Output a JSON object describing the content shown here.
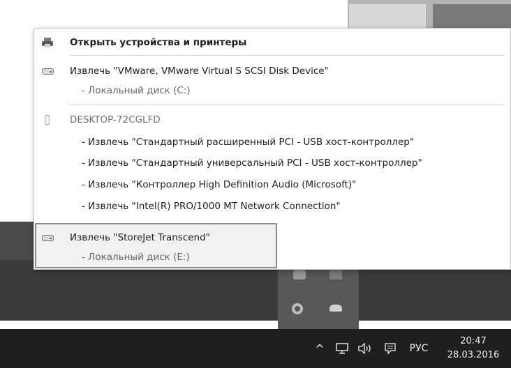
{
  "menu": {
    "open_devices": "Открыть устройства и принтеры",
    "eject_vmware": "Извлечь \"VMware, VMware Virtual S SCSI Disk Device\"",
    "local_disk_c": "- Локальный диск (C:)",
    "desktop_name": "DESKTOP-72CGLFD",
    "eject_items": [
      "- Извлечь \"Стандартный расширенный PCI - USB хост-контроллер\"",
      "- Извлечь \"Стандартный универсальный PCI - USB хост-контроллер\"",
      "- Извлечь \"Контроллер High Definition Audio (Microsoft)\"",
      "- Извлечь \"Intel(R) PRO/1000 MT Network Connection\""
    ],
    "eject_storejet": "Извлечь \"StoreJet Transcend\"",
    "local_disk_e": "- Локальный диск (E:)"
  },
  "taskbar": {
    "chevron": "^",
    "network_icon": "network-icon",
    "volume": "🕪)",
    "action_center_icon": "action-center-icon",
    "lang": "РУС",
    "time": "20:47",
    "date": "28.03.2016"
  },
  "colors": {
    "taskbar": "#1f1f1f",
    "highlight_border": "#8a8a8a"
  }
}
